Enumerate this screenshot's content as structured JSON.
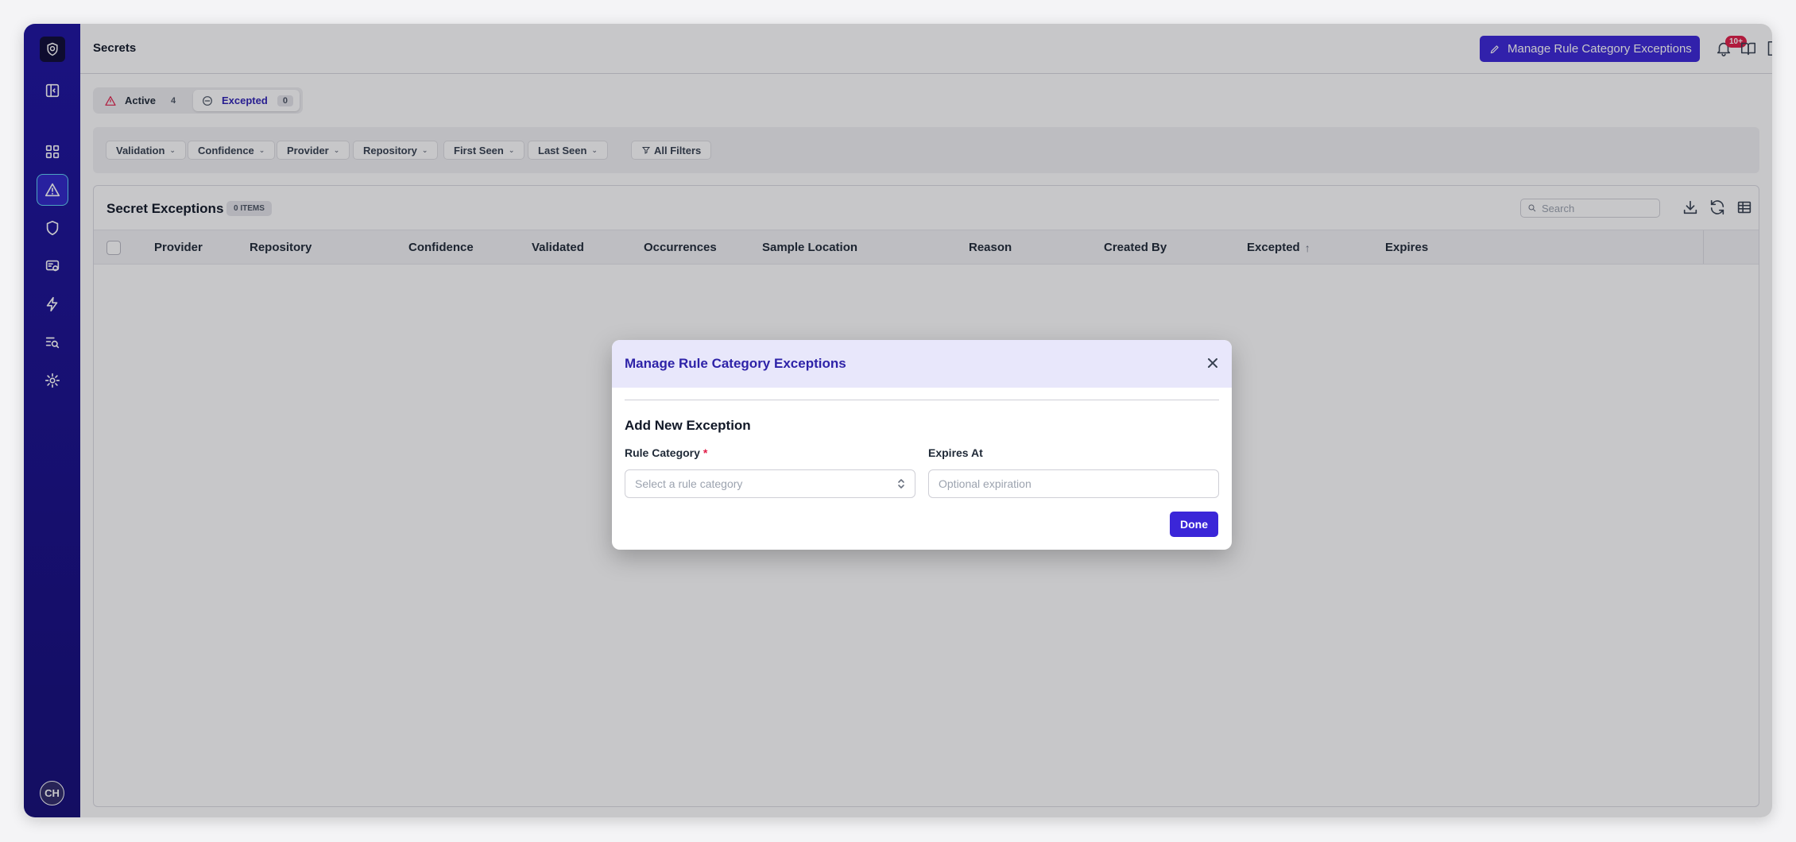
{
  "page": {
    "title": "Secrets"
  },
  "header": {
    "manage_button_label": "Manage Rule Category Exceptions",
    "notification_badge": "10+"
  },
  "status_toggle": {
    "active_label": "Active",
    "active_count": "4",
    "excepted_label": "Excepted",
    "excepted_count": "0"
  },
  "filters": [
    {
      "label": "Validation"
    },
    {
      "label": "Confidence"
    },
    {
      "label": "Provider"
    },
    {
      "label": "Repository"
    },
    {
      "label": "First Seen"
    },
    {
      "label": "Last Seen"
    },
    {
      "label": "All Filters"
    }
  ],
  "table": {
    "title": "Secret Exceptions",
    "count_label": "0 ITEMS",
    "search_placeholder": "Search",
    "columns": [
      {
        "label": "Provider"
      },
      {
        "label": "Repository"
      },
      {
        "label": "Confidence"
      },
      {
        "label": "Validated"
      },
      {
        "label": "Occurrences"
      },
      {
        "label": "Sample Location"
      },
      {
        "label": "Reason"
      },
      {
        "label": "Created By"
      },
      {
        "label": "Excepted",
        "sort": "ascending"
      },
      {
        "label": "Expires"
      }
    ],
    "rows": []
  },
  "sidebar": {
    "user_initials": "CH",
    "icons": [
      "logo-icon",
      "sidebar-toggle-icon",
      "dashboard-icon",
      "alert-triangle-icon",
      "shield-icon",
      "code-review-icon",
      "lightning-icon",
      "search-list-icon",
      "settings-icon"
    ]
  },
  "modal": {
    "title": "Manage Rule Category Exceptions",
    "subtitle": "Add New Exception",
    "rule_category_label": "Rule Category",
    "required_marker": "*",
    "rule_category_placeholder": "Select a rule category",
    "expires_label": "Expires At",
    "expires_placeholder": "Optional expiration",
    "done_label": "Done"
  },
  "colors": {
    "sidebar": "#1c12a0",
    "primary": "#3b26d8",
    "active_nav_border": "#5fd3f5",
    "badge": "#e11d48",
    "modal_header": "#e8e7fb"
  }
}
